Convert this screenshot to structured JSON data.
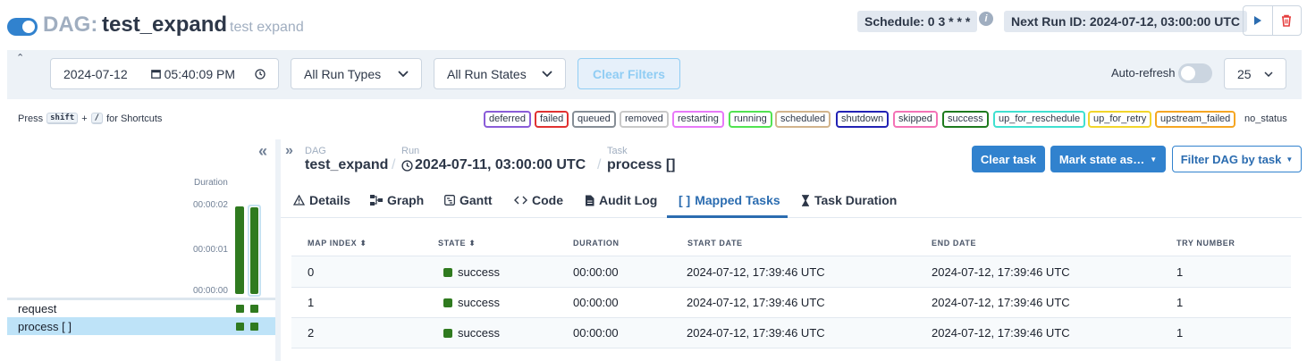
{
  "header": {
    "prefix": "DAG:",
    "dag_id": "test_expand",
    "description": "test expand",
    "schedule": "Schedule: 0 3 * * *",
    "next_run": "Next Run ID: 2024-07-12, 03:00:00 UTC"
  },
  "filters": {
    "date": "2024-07-12",
    "time": "05:40:09 PM",
    "run_types": "All Run Types",
    "run_states": "All Run States",
    "clear": "Clear Filters",
    "auto_refresh": "Auto-refresh",
    "page_size": "25"
  },
  "shortcuts": {
    "press": "Press",
    "key1": "shift",
    "plus": "+",
    "key2": "/",
    "suffix": "for Shortcuts"
  },
  "legend": [
    {
      "label": "deferred",
      "color": "#8a5cd8"
    },
    {
      "label": "failed",
      "color": "#e03131"
    },
    {
      "label": "queued",
      "color": "#868e96"
    },
    {
      "label": "removed",
      "color": "#c8c8c8"
    },
    {
      "label": "restarting",
      "color": "#e879f9"
    },
    {
      "label": "running",
      "color": "#51e351"
    },
    {
      "label": "scheduled",
      "color": "#d2b48c"
    },
    {
      "label": "shutdown",
      "color": "#2222b4"
    },
    {
      "label": "skipped",
      "color": "#f472b6"
    },
    {
      "label": "success",
      "color": "#1e7a1e"
    },
    {
      "label": "up_for_reschedule",
      "color": "#40e0d0"
    },
    {
      "label": "up_for_retry",
      "color": "#f2d52c"
    },
    {
      "label": "upstream_failed",
      "color": "#f5a623"
    },
    {
      "label": "no_status",
      "color": ""
    }
  ],
  "grid": {
    "duration_label": "Duration",
    "ticks": [
      "00:00:02",
      "00:00:01",
      "00:00:00"
    ],
    "tasks": [
      "request",
      "process [ ]"
    ]
  },
  "breadcrumb": {
    "dag_label": "DAG",
    "dag_value": "test_expand",
    "run_label": "Run",
    "run_value": "2024-07-11, 03:00:00 UTC",
    "task_label": "Task",
    "task_value": "process []"
  },
  "actions": {
    "clear_task": "Clear task",
    "mark_state": "Mark state as…",
    "filter_dag": "Filter DAG by task"
  },
  "tabs": [
    "Details",
    "Graph",
    "Gantt",
    "Code",
    "Audit Log",
    "Mapped Tasks",
    "Task Duration"
  ],
  "table": {
    "headers": [
      "Map Index",
      "State",
      "Duration",
      "Start Date",
      "End Date",
      "Try Number"
    ],
    "rows": [
      [
        "0",
        "success",
        "00:00:00",
        "2024-07-12, 17:39:46 UTC",
        "2024-07-12, 17:39:46 UTC",
        "1"
      ],
      [
        "1",
        "success",
        "00:00:00",
        "2024-07-12, 17:39:46 UTC",
        "2024-07-12, 17:39:46 UTC",
        "1"
      ],
      [
        "2",
        "success",
        "00:00:00",
        "2024-07-12, 17:39:46 UTC",
        "2024-07-12, 17:39:46 UTC",
        "1"
      ]
    ]
  },
  "colors": {
    "accent": "#3182ce",
    "success": "#2f7a1f"
  }
}
